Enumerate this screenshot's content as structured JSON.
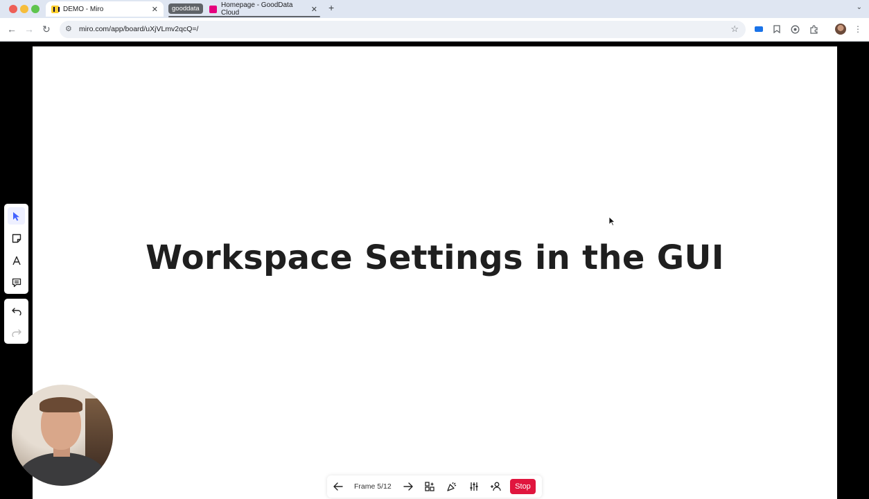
{
  "browser": {
    "tabs": [
      {
        "title": "DEMO - Miro",
        "favicon": "miro-logo-icon",
        "active": true
      },
      {
        "title": "Homepage - GoodData Cloud",
        "favicon": "gooddata-logo-icon",
        "active": false
      }
    ],
    "tab_group_label": "gooddata",
    "url": "miro.com/app/board/uXjVLmv2qcQ=/"
  },
  "board": {
    "slide_title": "Workspace Settings in the GUI"
  },
  "left_toolbar": {
    "tools": [
      "select-cursor-icon",
      "sticky-note-icon",
      "text-icon",
      "comment-icon"
    ],
    "history": [
      "undo-icon",
      "redo-icon"
    ]
  },
  "presentation_bar": {
    "frame_label": "Frame 5/12",
    "stop_label": "Stop",
    "stop_color": "#e0163e"
  },
  "colors": {
    "tabbar_bg": "#dfe6f2",
    "frame_bg": "#ffffff",
    "title_text": "#1f1f1f",
    "selected_tool": "#4262ff"
  }
}
